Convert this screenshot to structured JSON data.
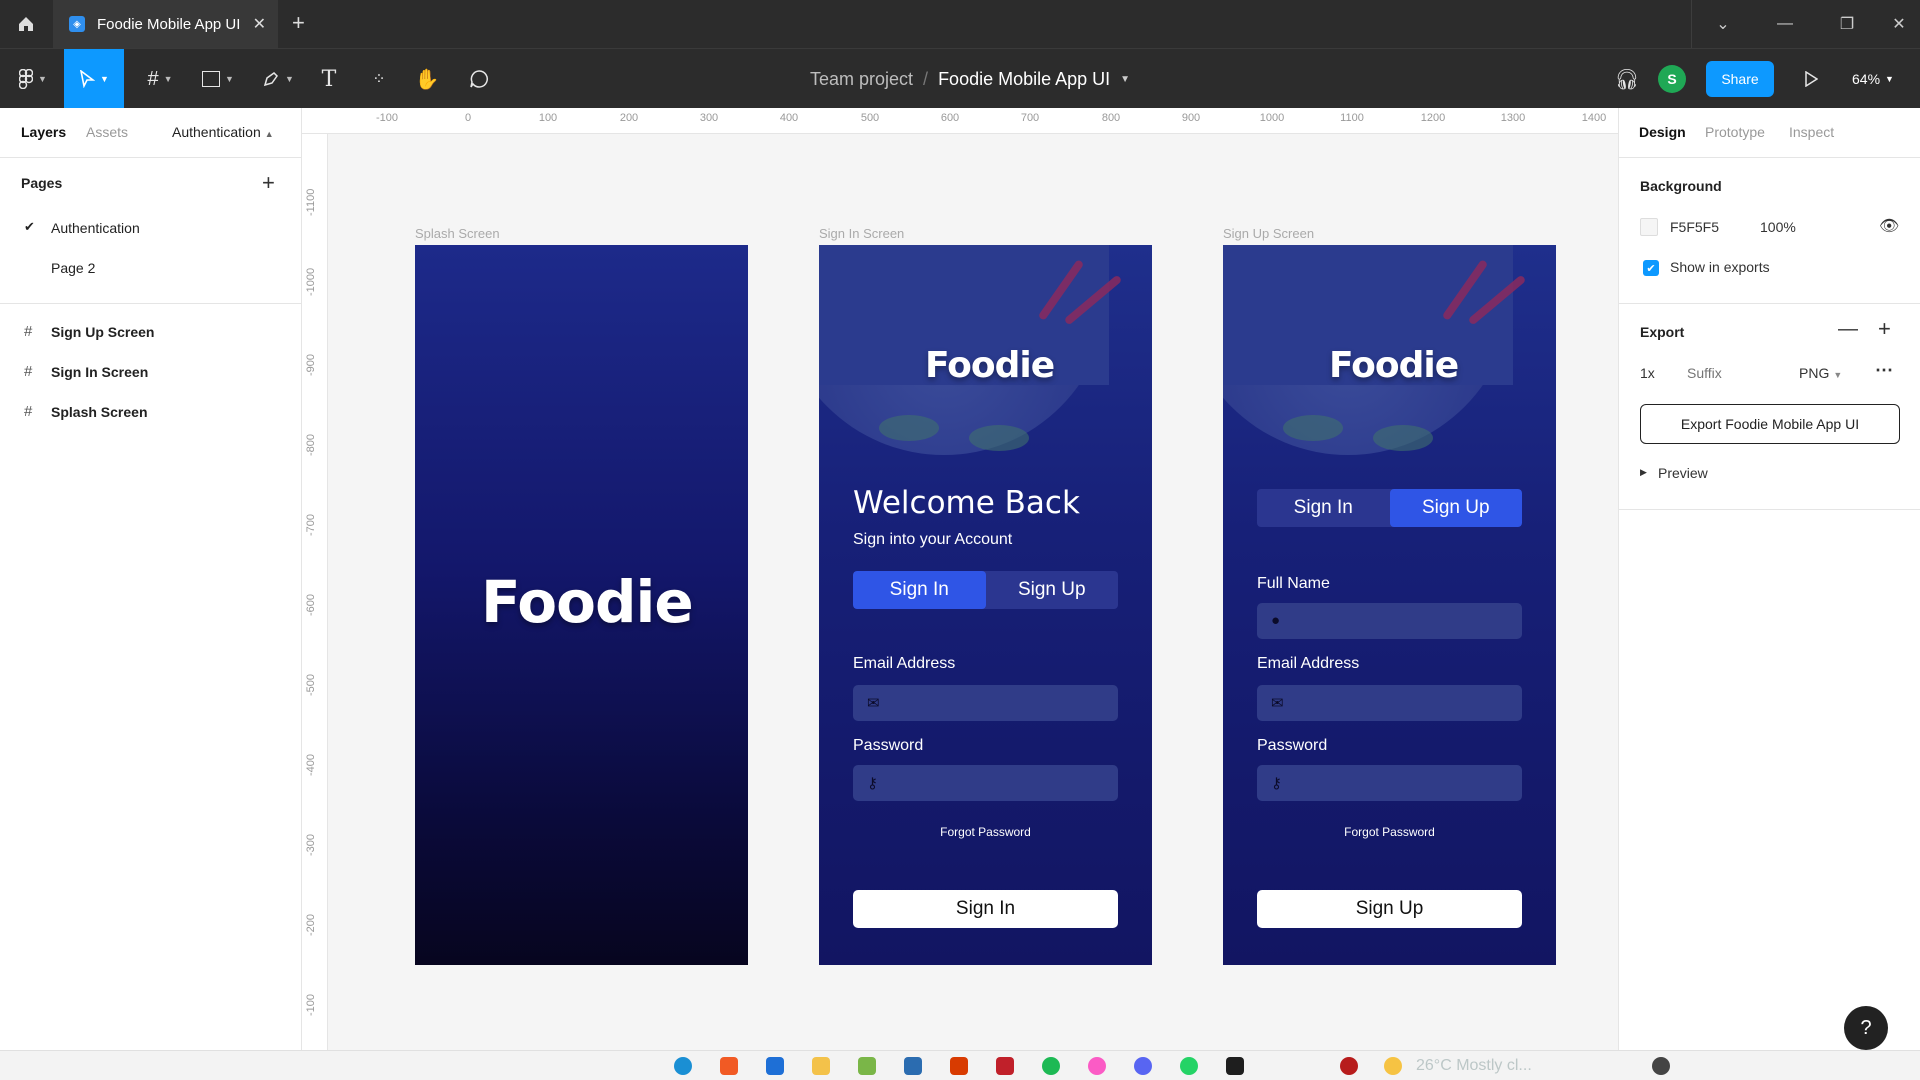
{
  "titlebar": {
    "tab_title": "Foodie Mobile App UI",
    "close": "✕",
    "new_tab": "+"
  },
  "toolbar": {
    "project": "Team project",
    "separator": "/",
    "file_name": "Foodie Mobile App UI",
    "avatar_initial": "S",
    "share_label": "Share",
    "zoom": "64%"
  },
  "left_panel": {
    "tabs": [
      "Layers",
      "Assets"
    ],
    "current_page": "Authentication",
    "pages_title": "Pages",
    "pages": [
      "Authentication",
      "Page 2"
    ],
    "layers": [
      "Sign Up Screen",
      "Sign In Screen",
      "Splash Screen"
    ]
  },
  "rulers": {
    "top": [
      "-100",
      "0",
      "100",
      "200",
      "300",
      "400",
      "500",
      "600",
      "700",
      "800",
      "900",
      "1000",
      "1100",
      "1200",
      "1300",
      "1400"
    ],
    "left": [
      "-1100",
      "-1000",
      "-900",
      "-800",
      "-700",
      "-600",
      "-500",
      "-400",
      "-300",
      "-200",
      "-100"
    ]
  },
  "canvas": {
    "splash": {
      "label": "Splash Screen",
      "logo": "Foodie"
    },
    "signin": {
      "label": "Sign In Screen",
      "logo": "Foodie",
      "title": "Welcome Back",
      "subtitle": "Sign into your Account",
      "tab_signin": "Sign In",
      "tab_signup": "Sign Up",
      "email_label": "Email Address",
      "password_label": "Password",
      "forgot": "Forgot Password",
      "button": "Sign In"
    },
    "signup": {
      "label": "Sign Up Screen",
      "logo": "Foodie",
      "tab_signin": "Sign In",
      "tab_signup": "Sign Up",
      "fullname_label": "Full Name",
      "email_label": "Email Address",
      "password_label": "Password",
      "forgot": "Forgot Password",
      "button": "Sign Up"
    },
    "brand_color": "#1a2579"
  },
  "right_panel": {
    "tabs": [
      "Design",
      "Prototype",
      "Inspect"
    ],
    "background_title": "Background",
    "bg_hex": "F5F5F5",
    "bg_opacity": "100%",
    "show_in_exports": "Show in exports",
    "export_title": "Export",
    "export_scale": "1x",
    "export_suffix_placeholder": "Suffix",
    "export_format": "PNG",
    "export_button": "Export Foodie Mobile App UI",
    "preview": "Preview"
  },
  "help": "?",
  "taskbar": {
    "weather": "26°C  Mostly cl..."
  }
}
